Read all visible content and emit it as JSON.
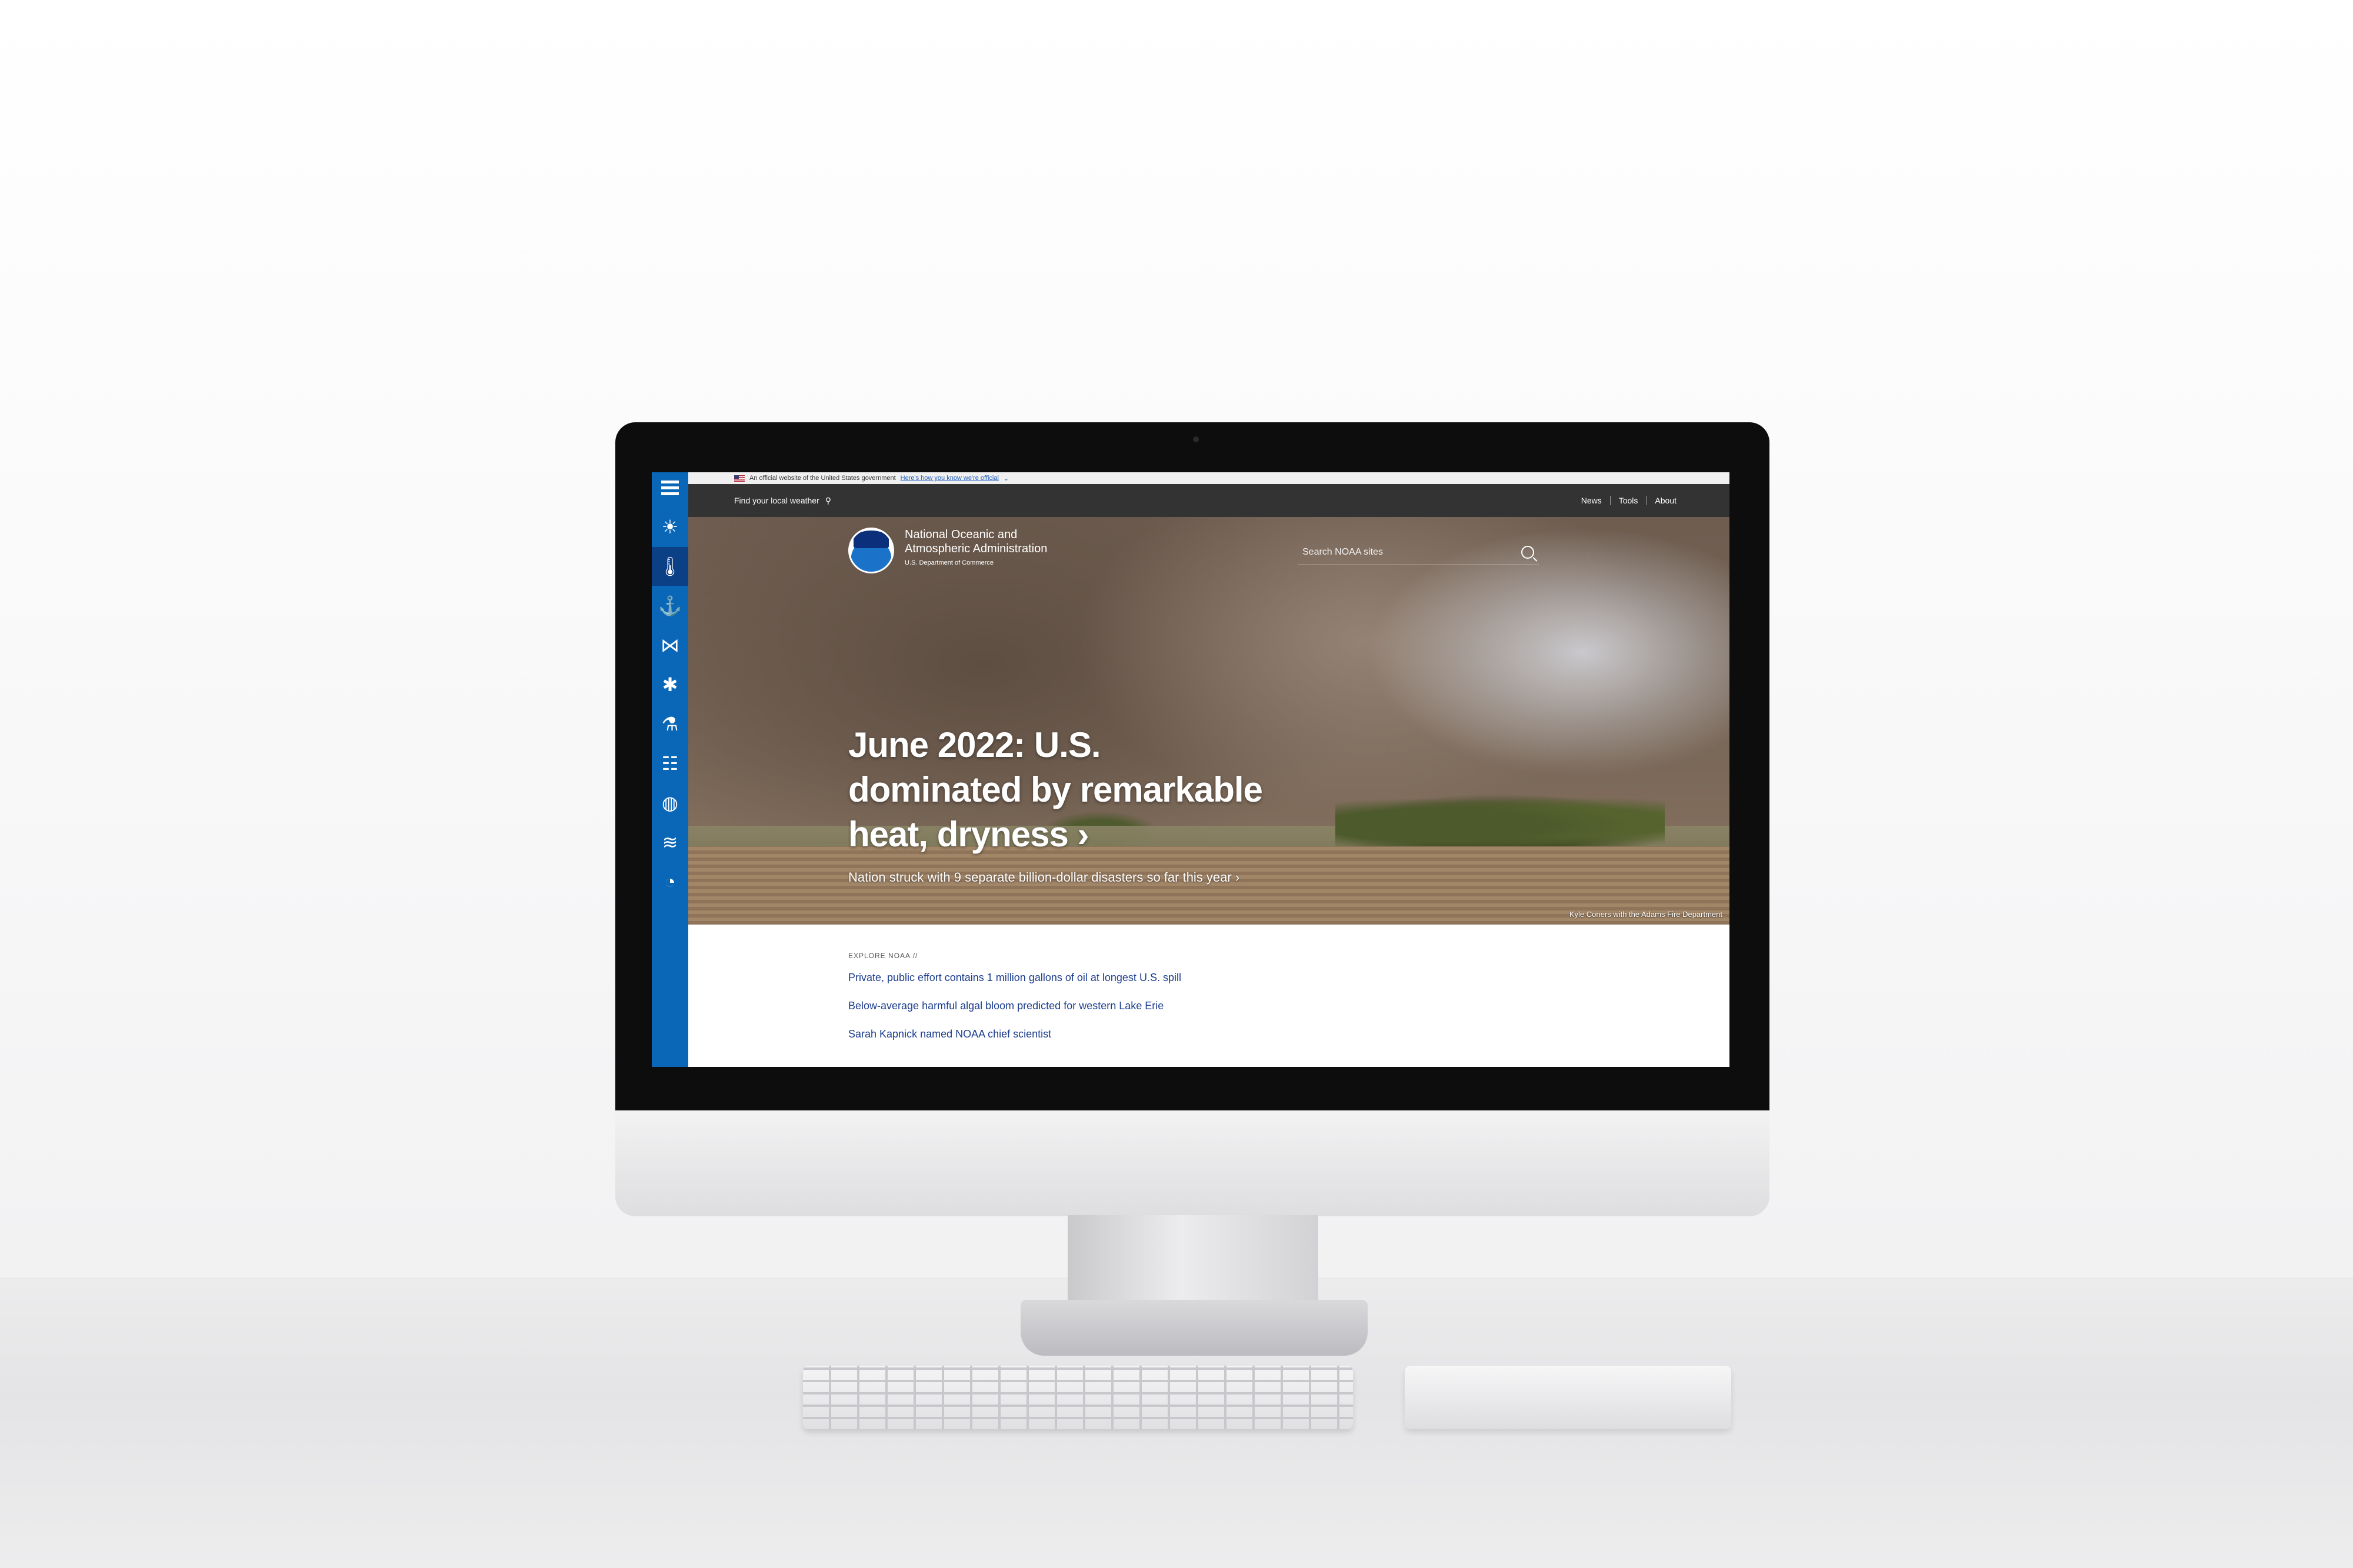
{
  "gov_banner": {
    "text": "An official website of the United States government",
    "link": "Here's how you know we're official"
  },
  "topbar": {
    "local_weather": "Find your local weather",
    "nav": [
      "News",
      "Tools",
      "About"
    ]
  },
  "sidebar": {
    "items": [
      {
        "icon": "weather-icon"
      },
      {
        "icon": "thermometer-icon",
        "active": true
      },
      {
        "icon": "coast-icon"
      },
      {
        "icon": "fish-icon"
      },
      {
        "icon": "satellite-icon"
      },
      {
        "icon": "research-flask-icon"
      },
      {
        "icon": "climate-icon"
      },
      {
        "icon": "globe-icon"
      },
      {
        "icon": "ocean-icon"
      },
      {
        "icon": "education-apple-icon"
      }
    ]
  },
  "header": {
    "org_name": "National Oceanic and Atmospheric Administration",
    "org_dept": "U.S. Department of Commerce",
    "search_placeholder": "Search NOAA sites"
  },
  "hero": {
    "headline": "June 2022: U.S. dominated by remarkable heat, dryness",
    "subhead": "Nation struck with 9 separate billion-dollar disasters so far this year",
    "credit": "Kyle Coners with the Adams Fire Department"
  },
  "explore": {
    "label": "EXPLORE NOAA //",
    "links": [
      "Private, public effort contains 1 million gallons of oil at longest U.S. spill",
      "Below-average harmful algal bloom predicted for western Lake Erie",
      "Sarah Kapnick named NOAA chief scientist"
    ]
  },
  "colors": {
    "sidebar": "#0a67b8",
    "sidebar_active": "#0b3f86",
    "topbar": "#333333",
    "link": "#1c3d8f"
  }
}
